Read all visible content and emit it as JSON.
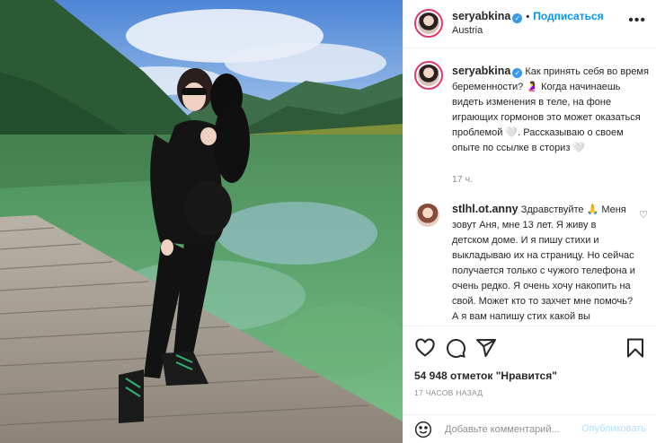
{
  "post": {
    "username": "seryabkina",
    "separator": "•",
    "follow_label": "Подписаться",
    "location": "Austria",
    "more_glyph": "•••",
    "caption_text": "Как принять себя во время беременности? 🤰 Когда начинаешь видеть изменения в теле, на фоне играющих гормонов это может оказаться проблемой 🤍. Рассказываю о своем опыте по ссылке в сториз 🤍",
    "caption_time": "17 ч."
  },
  "comment": {
    "username": "stlhl.ot.anny",
    "text": "Здравствуйте 🙏 Меня зовут Аня, мне 13 лет. Я живу в детском доме. И я пишу стихи и выкладываю их на страницу. Но сейчас получается только с чужого телефона и очень редко. Я очень хочу накопить на свой. Может кто то захчет мне помочь? А я вам напишу стих какой вы",
    "heart_glyph": "♡"
  },
  "actions": {
    "likes_text": "54 948 отметок \"Нравится\"",
    "time_ago": "17 ЧАСОВ НАЗАД"
  },
  "composer": {
    "placeholder": "Добавьте комментарий...",
    "publish_label": "Опубликовать"
  },
  "icons": [
    "heart-icon",
    "comment-icon",
    "share-icon",
    "bookmark-icon",
    "emoji-icon",
    "verified-icon"
  ],
  "colors": {
    "accent": "#0095f6",
    "verified": "#3897f0",
    "muted": "#8e8e8e",
    "publish_disabled": "#b2dffc"
  }
}
